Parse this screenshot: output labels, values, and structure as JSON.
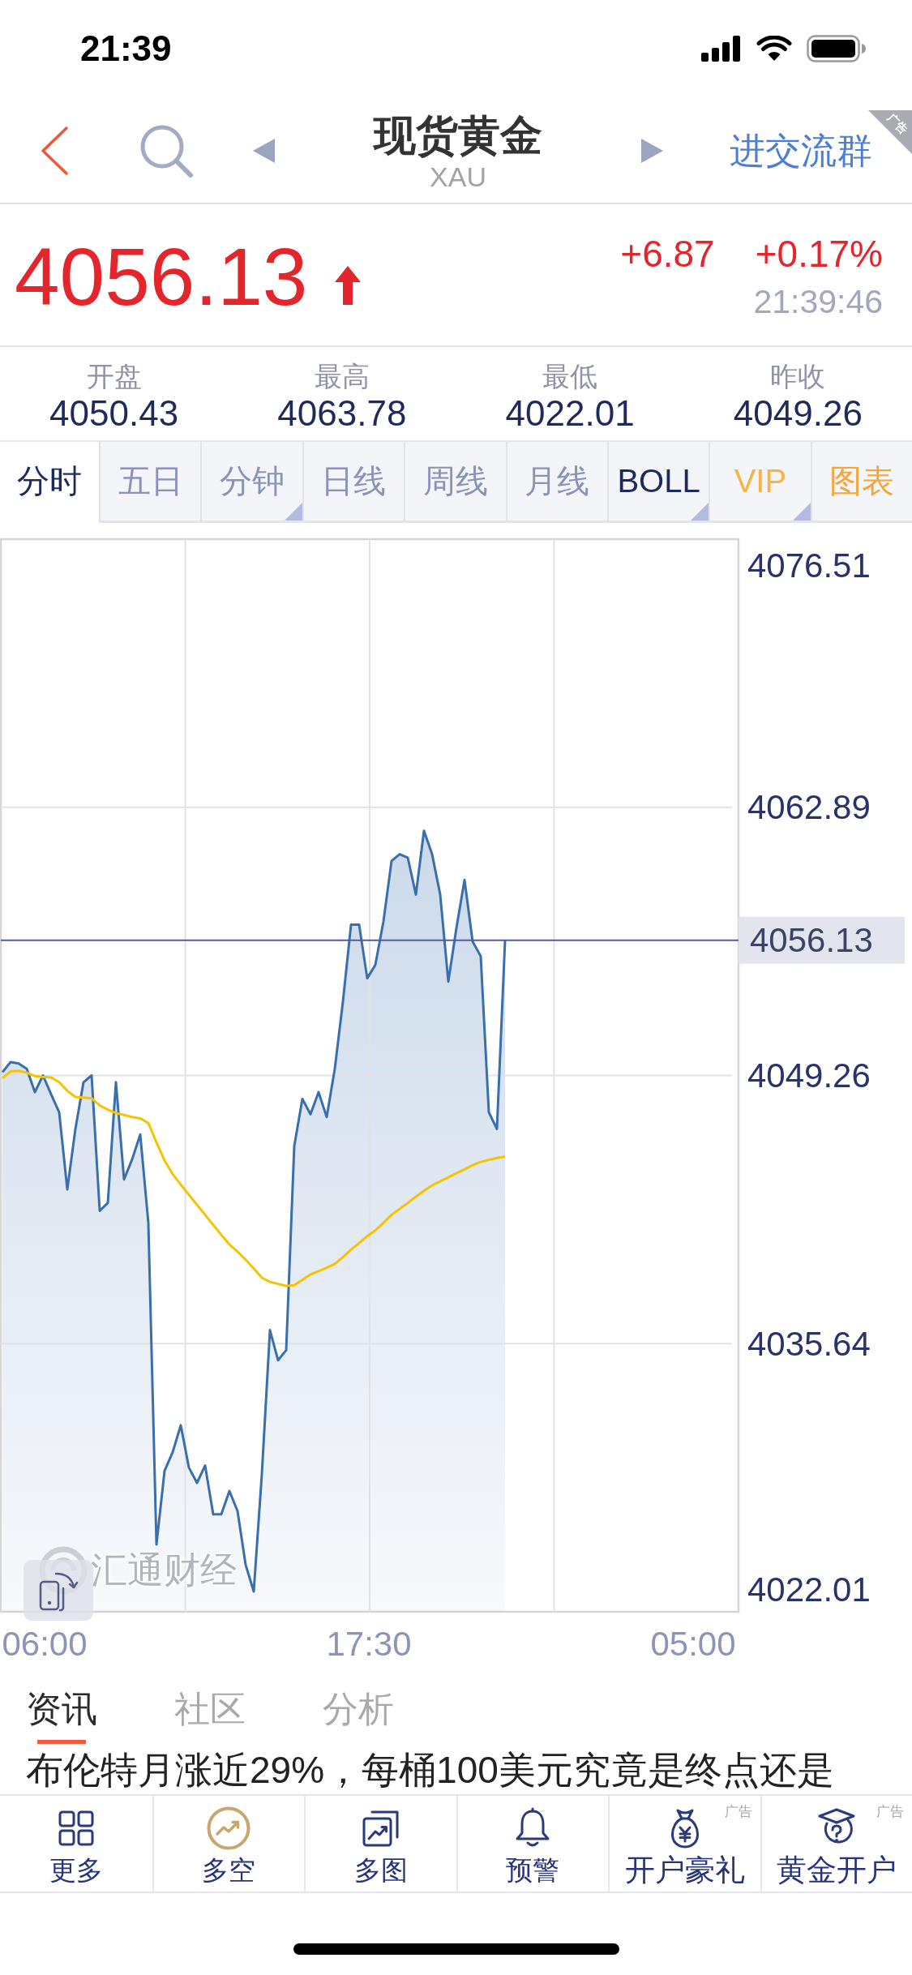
{
  "status_bar": {
    "time": "21:39"
  },
  "nav": {
    "title": "现货黄金",
    "symbol": "XAU",
    "group_link": "进交流群",
    "ad_tag": "广告"
  },
  "quote": {
    "price": "4056.13",
    "rising": true,
    "change": "+6.87",
    "change_percent": "+0.17%",
    "time": "21:39:46"
  },
  "stats": [
    {
      "label": "开盘",
      "value": "4050.43"
    },
    {
      "label": "最高",
      "value": "4063.78"
    },
    {
      "label": "最低",
      "value": "4022.01"
    },
    {
      "label": "昨收",
      "value": "4049.26"
    }
  ],
  "period_tabs": [
    {
      "label": "分时",
      "selected": true,
      "dropdown": false,
      "color": "#1d2a5c"
    },
    {
      "label": "五日",
      "selected": false,
      "dropdown": false,
      "color": "#8a92b8"
    },
    {
      "label": "分钟",
      "selected": false,
      "dropdown": true,
      "color": "#8a92b8"
    },
    {
      "label": "日线",
      "selected": false,
      "dropdown": false,
      "color": "#8a92b8"
    },
    {
      "label": "周线",
      "selected": false,
      "dropdown": false,
      "color": "#8a92b8"
    },
    {
      "label": "月线",
      "selected": false,
      "dropdown": false,
      "color": "#8a92b8"
    },
    {
      "label": "BOLL",
      "selected": false,
      "dropdown": true,
      "color": "#1d2a5c"
    },
    {
      "label": "VIP",
      "selected": false,
      "dropdown": true,
      "color": "#f6b443"
    },
    {
      "label": "图表",
      "selected": false,
      "dropdown": false,
      "color": "#f7a53a"
    }
  ],
  "chart": {
    "chart_data": {
      "type": "line",
      "grid": true,
      "categories": [
        null,
        null,
        null,
        null,
        null,
        "06:00",
        null,
        null,
        null,
        null,
        null,
        null,
        null,
        null,
        null,
        null,
        null,
        null,
        null,
        null,
        null,
        null,
        null,
        null,
        null,
        null,
        null,
        null,
        null,
        null,
        null,
        null,
        null,
        null,
        null,
        null,
        null,
        null,
        null,
        null,
        null,
        null,
        null,
        null,
        null,
        "17:30",
        null,
        null,
        null,
        null,
        null,
        null,
        null,
        null,
        null,
        null,
        null,
        null,
        null,
        null,
        null,
        null,
        null,
        null,
        null,
        null,
        null,
        null,
        null,
        null,
        null,
        null,
        null,
        null,
        null,
        null,
        null,
        null,
        null,
        null,
        null,
        null,
        null,
        null,
        null,
        "05:00",
        null,
        null,
        null,
        null,
        null,
        null
      ],
      "ylim": [
        4022.01,
        4076.51
      ],
      "yticks": [
        4076.51,
        4062.89,
        4049.26,
        4035.64,
        4022.01
      ],
      "series": [
        {
          "color": "#3a6fae",
          "values": [
            4049.43,
            4049.94,
            4049.87,
            4049.6,
            4048.41,
            4049.26,
            4048.31,
            4047.39,
            4043.47,
            4046.54,
            4048.92,
            4049.26,
            4042.38,
            4042.79,
            4048.92,
            4043.98,
            4045.0,
            4046.26,
            4041.77,
            4025.43,
            4029.17,
            4030.12,
            4031.49,
            4029.34,
            4028.56,
            4029.44,
            4026.96,
            4026.96,
            4028.15,
            4027.13,
            4024.4,
            4023.04,
            4029.0,
            4036.32,
            4034.79,
            4035.3,
            4045.68,
            4048.07,
            4047.29,
            4048.41,
            4047.15,
            4049.6,
            4053.01,
            4056.92,
            4056.92,
            4054.2,
            4054.88,
            4057.09,
            4060.16,
            4060.5,
            4060.33,
            4058.45,
            4061.69,
            4060.5,
            4058.45,
            4054.03,
            4056.75,
            4059.2,
            4056.07,
            4055.32,
            4047.39,
            4046.54,
            4056.13,
            null,
            null,
            null,
            null,
            null,
            null,
            null,
            null,
            null,
            null,
            null,
            null,
            null,
            null,
            null,
            null,
            null,
            null,
            null,
            null,
            null,
            null,
            null,
            null,
            null,
            null,
            null,
            null,
            null
          ]
        },
        {
          "color": "#f5c300",
          "values": [
            4049.12,
            4049.46,
            4049.5,
            4049.4,
            4049.23,
            4049.19,
            4049.16,
            4048.92,
            4048.48,
            4048.17,
            4048.14,
            4048.1,
            4047.73,
            4047.52,
            4047.35,
            4047.25,
            4047.15,
            4047.08,
            4046.84,
            4045.86,
            4044.94,
            4044.25,
            4043.71,
            4043.2,
            4042.69,
            4042.18,
            4041.67,
            4041.16,
            4040.68,
            4040.31,
            4039.9,
            4039.45,
            4038.98,
            4038.77,
            4038.67,
            4038.57,
            4038.6,
            4038.88,
            4039.15,
            4039.32,
            4039.49,
            4039.69,
            4040.03,
            4040.41,
            4040.75,
            4041.09,
            4041.39,
            4041.77,
            4042.18,
            4042.48,
            4042.79,
            4043.1,
            4043.4,
            4043.68,
            4043.88,
            4044.08,
            4044.29,
            4044.49,
            4044.7,
            4044.87,
            4044.97,
            4045.07,
            4045.14,
            null,
            null,
            null,
            null,
            null,
            null,
            null,
            null,
            null,
            null,
            null,
            null,
            null,
            null,
            null,
            null,
            null,
            null,
            null,
            null,
            null,
            null,
            null,
            null,
            null,
            null,
            null,
            null,
            null
          ]
        }
      ],
      "ref_lines": [
        {
          "axis": "y",
          "value": 4056.13,
          "label": "4056.13"
        }
      ]
    },
    "watermark": "汇通财经"
  },
  "news_tabs": [
    {
      "label": "资讯",
      "selected": true
    },
    {
      "label": "社区",
      "selected": false
    },
    {
      "label": "分析",
      "selected": false
    }
  ],
  "headline": "布伦特月涨近29%，每桶100美元究竟是终点还是",
  "bottom_bar": [
    {
      "label": "更多",
      "kind": "more"
    },
    {
      "label": "多空",
      "kind": "long-short"
    },
    {
      "label": "多图",
      "kind": "multi-chart"
    },
    {
      "label": "预警",
      "kind": "alert"
    },
    {
      "label": "开户豪礼",
      "kind": "account-gift",
      "ad_tag": "广告"
    },
    {
      "label": "黄金开户",
      "kind": "gold-account",
      "ad_tag": "广告"
    }
  ]
}
